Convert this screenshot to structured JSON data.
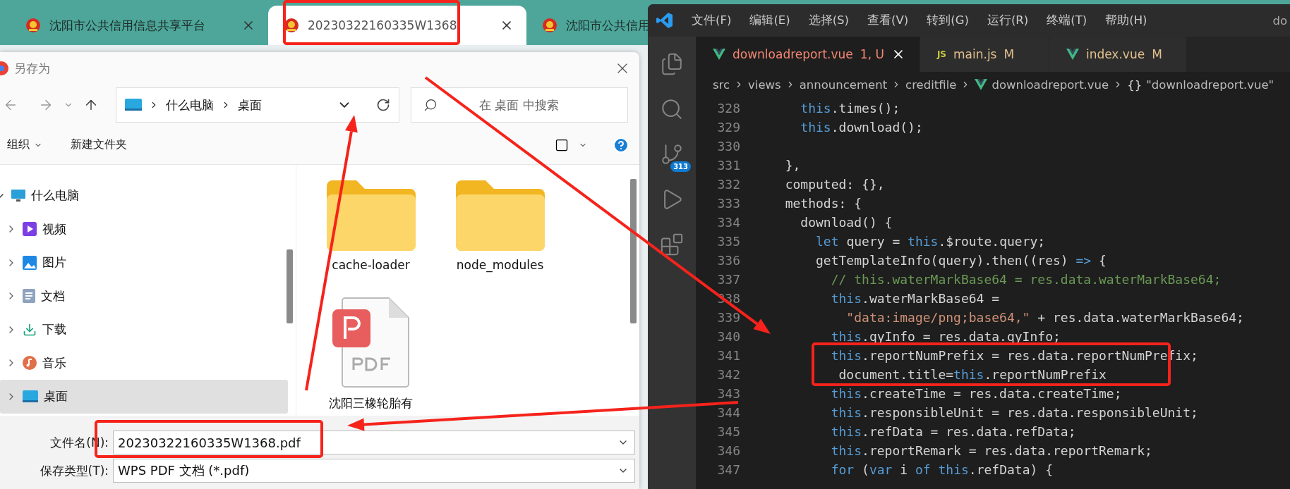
{
  "browser": {
    "tabs": [
      {
        "title": "沈阳市公共信用信息共享平台",
        "selected": false
      },
      {
        "title": "20230322160335W1368",
        "selected": true
      },
      {
        "title": "沈阳市公共信用",
        "selected": false
      }
    ]
  },
  "dialog": {
    "title": "另存为",
    "address": {
      "segments": [
        "什么电脑",
        "桌面"
      ]
    },
    "search": {
      "placeholder": "在 桌面 中搜索"
    },
    "toolbar": {
      "organize": "组织",
      "new_folder": "新建文件夹"
    },
    "tree": [
      {
        "label": "什么电脑",
        "expanded": true,
        "selected": false,
        "children": [
          {
            "label": "视频",
            "expanded": false,
            "selected": false
          },
          {
            "label": "图片",
            "expanded": false,
            "selected": false
          },
          {
            "label": "文档",
            "expanded": false,
            "selected": false
          },
          {
            "label": "下载",
            "expanded": false,
            "selected": false
          },
          {
            "label": "音乐",
            "expanded": false,
            "selected": false
          },
          {
            "label": "桌面",
            "expanded": false,
            "selected": true
          }
        ]
      }
    ],
    "files": [
      {
        "name": "cache-loader",
        "kind": "folder"
      },
      {
        "name": "node_modules",
        "kind": "folder"
      },
      {
        "name": "沈阳三橡轮胎有",
        "kind": "pdf"
      }
    ],
    "file_name": {
      "label": "文件名(N):",
      "value": "20230322160335W1368.pdf"
    },
    "file_type": {
      "label": "保存类型(T):",
      "value": "WPS PDF 文档 (*.pdf)"
    }
  },
  "editor": {
    "menu": [
      "文件(F)",
      "编辑(E)",
      "选择(S)",
      "查看(V)",
      "转到(G)",
      "运行(R)",
      "终端(T)",
      "帮助(H)"
    ],
    "window_title": "do",
    "source_control_badge": "313",
    "tabs": [
      {
        "name": "downloadreport.vue",
        "status": "1, U",
        "kind": "vue",
        "selected": true,
        "error": true
      },
      {
        "name": "main.js",
        "status": "M",
        "kind": "js",
        "icon_text": "JS",
        "selected": false,
        "error": false
      },
      {
        "name": "index.vue",
        "status": "M",
        "kind": "vue",
        "selected": false,
        "error": false
      }
    ],
    "breadcrumb": [
      {
        "text": "src",
        "kind": "folder"
      },
      {
        "text": "views",
        "kind": "folder"
      },
      {
        "text": "announcement",
        "kind": "folder"
      },
      {
        "text": "creditfile",
        "kind": "folder"
      },
      {
        "text": "downloadreport.vue",
        "kind": "file"
      },
      {
        "text": "\"downloadreport.vue\"",
        "kind": "symbol",
        "symbol": "{}"
      }
    ],
    "lines": [
      {
        "number": "328",
        "tokens": [
          {
            "kind": "keyword",
            "text": "    this"
          },
          {
            "kind": "plain",
            "text": ".times();"
          }
        ]
      },
      {
        "number": "329",
        "tokens": [
          {
            "kind": "keyword",
            "text": "    this"
          },
          {
            "kind": "plain",
            "text": ".download();"
          }
        ]
      },
      {
        "number": "330"
      },
      {
        "number": "331",
        "tokens": [
          {
            "kind": "plain",
            "text": "  },"
          }
        ]
      },
      {
        "number": "332",
        "tokens": [
          {
            "kind": "plain",
            "text": "  computed: {},"
          }
        ]
      },
      {
        "number": "333",
        "tokens": [
          {
            "kind": "plain",
            "text": "  methods: {"
          }
        ]
      },
      {
        "number": "334",
        "tokens": [
          {
            "kind": "plain",
            "text": "    download() {"
          }
        ]
      },
      {
        "number": "335",
        "tokens": [
          {
            "kind": "keyword",
            "text": "      let"
          },
          {
            "kind": "plain",
            "text": " query = "
          },
          {
            "kind": "keyword",
            "text": "this"
          },
          {
            "kind": "plain",
            "text": ".$route.query;"
          }
        ]
      },
      {
        "number": "336",
        "tokens": [
          {
            "kind": "plain",
            "text": "      getTemplateInfo(query).then((res) "
          },
          {
            "kind": "keyword",
            "text": "=>"
          },
          {
            "kind": "plain",
            "text": " {"
          }
        ]
      },
      {
        "number": "337",
        "tokens": [
          {
            "kind": "comment",
            "text": "        // this.waterMarkBase64 = res.data.waterMarkBase64;"
          }
        ]
      },
      {
        "number": "338",
        "tokens": [
          {
            "kind": "keyword",
            "text": "        this"
          },
          {
            "kind": "plain",
            "text": ".waterMarkBase64 ="
          }
        ]
      },
      {
        "number": "339",
        "tokens": [
          {
            "kind": "string",
            "text": "          \"data:image/png;base64,\""
          },
          {
            "kind": "plain",
            "text": " + res.data.waterMarkBase64;"
          }
        ]
      },
      {
        "number": "340",
        "tokens": [
          {
            "kind": "keyword",
            "text": "        this"
          },
          {
            "kind": "plain",
            "text": ".qyInfo = res.data.qyInfo;"
          }
        ]
      },
      {
        "number": "341",
        "tokens": [
          {
            "kind": "keyword",
            "text": "        this"
          },
          {
            "kind": "plain",
            "text": ".reportNumPrefix = res.data.reportNumPrefix;"
          }
        ]
      },
      {
        "number": "342",
        "tokens": [
          {
            "kind": "plain",
            "text": "         document.title="
          },
          {
            "kind": "keyword",
            "text": "this"
          },
          {
            "kind": "plain",
            "text": ".reportNumPrefix"
          }
        ]
      },
      {
        "number": "343",
        "tokens": [
          {
            "kind": "keyword",
            "text": "        this"
          },
          {
            "kind": "plain",
            "text": ".createTime = res.data.createTime;"
          }
        ]
      },
      {
        "number": "344",
        "tokens": [
          {
            "kind": "keyword",
            "text": "        this"
          },
          {
            "kind": "plain",
            "text": ".responsibleUnit = res.data.responsibleUnit;"
          }
        ]
      },
      {
        "number": "345",
        "tokens": [
          {
            "kind": "keyword",
            "text": "        this"
          },
          {
            "kind": "plain",
            "text": ".refData = res.data.refData;"
          }
        ]
      },
      {
        "number": "346",
        "tokens": [
          {
            "kind": "keyword",
            "text": "        this"
          },
          {
            "kind": "plain",
            "text": ".reportRemark = res.data.reportRemark;"
          }
        ]
      },
      {
        "number": "347",
        "tokens": [
          {
            "kind": "keyword",
            "text": "        for"
          },
          {
            "kind": "plain",
            "text": " ("
          },
          {
            "kind": "keyword",
            "text": "var"
          },
          {
            "kind": "plain",
            "text": " i "
          },
          {
            "kind": "keyword",
            "text": "of"
          },
          {
            "kind": "keyword",
            "text": " this"
          },
          {
            "kind": "plain",
            "text": ".refData) {"
          }
        ]
      }
    ]
  }
}
